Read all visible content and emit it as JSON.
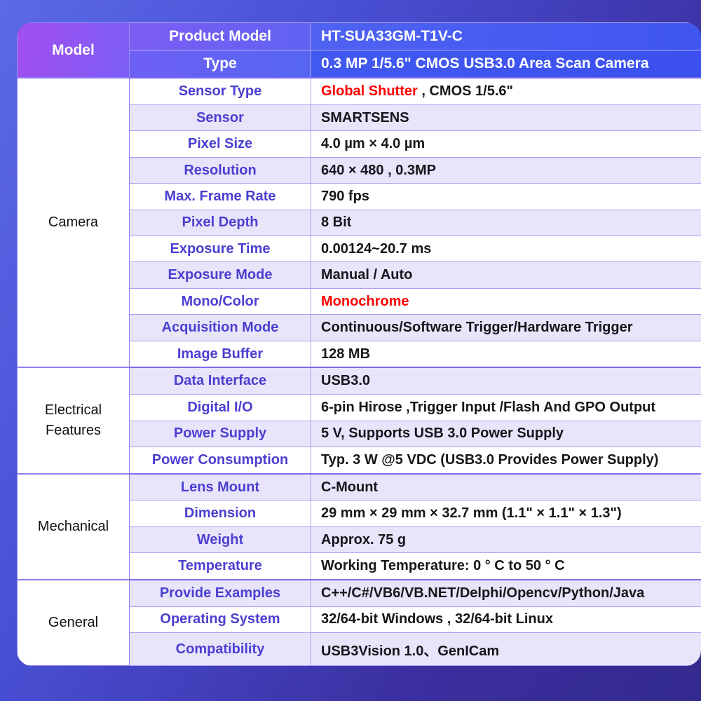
{
  "card": {
    "accent_purple": "#a24ef0",
    "accent_blue": "#3f56ef",
    "highlight_red": "#ff0000",
    "label_color": "#4a3fd0",
    "row_stripe": "#e8e4fa"
  },
  "sections": [
    {
      "category": "Model",
      "header": true,
      "rows": [
        {
          "label": "Product Model",
          "value": "HT-SUA33GM-T1V-C"
        },
        {
          "label": "Type",
          "value": "0.3 MP 1/5.6\" CMOS USB3.0 Area Scan Camera"
        }
      ]
    },
    {
      "category": "Camera",
      "header": false,
      "rows": [
        {
          "label": "Sensor Type",
          "value_red": "Global Shutter",
          "value": " , CMOS  1/5.6\""
        },
        {
          "label": "Sensor",
          "value": "SMARTSENS"
        },
        {
          "label": "Pixel Size",
          "value": "4.0 µm × 4.0 µm"
        },
        {
          "label": "Resolution",
          "value": "640 × 480 ,  0.3MP"
        },
        {
          "label": "Max. Frame Rate",
          "value": "790 fps"
        },
        {
          "label": "Pixel Depth",
          "value": "8 Bit"
        },
        {
          "label": "Exposure Time",
          "value": "0.00124~20.7 ms"
        },
        {
          "label": "Exposure Mode",
          "value": "Manual / Auto"
        },
        {
          "label": "Mono/Color",
          "value_red": "Monochrome",
          "value": ""
        },
        {
          "label": "Acquisition Mode",
          "value": "Continuous/Software Trigger/Hardware Trigger"
        },
        {
          "label": "Image Buffer",
          "value": "128 MB"
        }
      ]
    },
    {
      "category": "Electrical Features",
      "header": false,
      "rows": [
        {
          "label": "Data Interface",
          "value": "USB3.0"
        },
        {
          "label": "Digital I/O",
          "value": "6-pin Hirose ,Trigger Input /Flash And GPO Output"
        },
        {
          "label": "Power Supply",
          "value": "5 V, Supports USB 3.0 Power Supply"
        },
        {
          "label": "Power Consumption",
          "value": "Typ. 3 W @5 VDC (USB3.0 Provides Power Supply)"
        }
      ]
    },
    {
      "category": "Mechanical",
      "header": false,
      "rows": [
        {
          "label": "Lens Mount",
          "value": "C-Mount"
        },
        {
          "label": "Dimension",
          "value": "29 mm × 29 mm × 32.7 mm (1.1\" × 1.1\" × 1.3\")"
        },
        {
          "label": "Weight",
          "value": "Approx. 75 g"
        },
        {
          "label": "Temperature",
          "value": "Working Temperature: 0 ° C to 50 ° C"
        }
      ]
    },
    {
      "category": "General",
      "header": false,
      "rows": [
        {
          "label": "Provide Examples",
          "value": "C++/C#/VB6/VB.NET/Delphi/Opencv/Python/Java"
        },
        {
          "label": "Operating System",
          "value": "32/64-bit Windows , 32/64-bit Linux"
        },
        {
          "label": "Compatibility",
          "value": "USB3Vision 1.0、GenICam"
        }
      ]
    }
  ]
}
